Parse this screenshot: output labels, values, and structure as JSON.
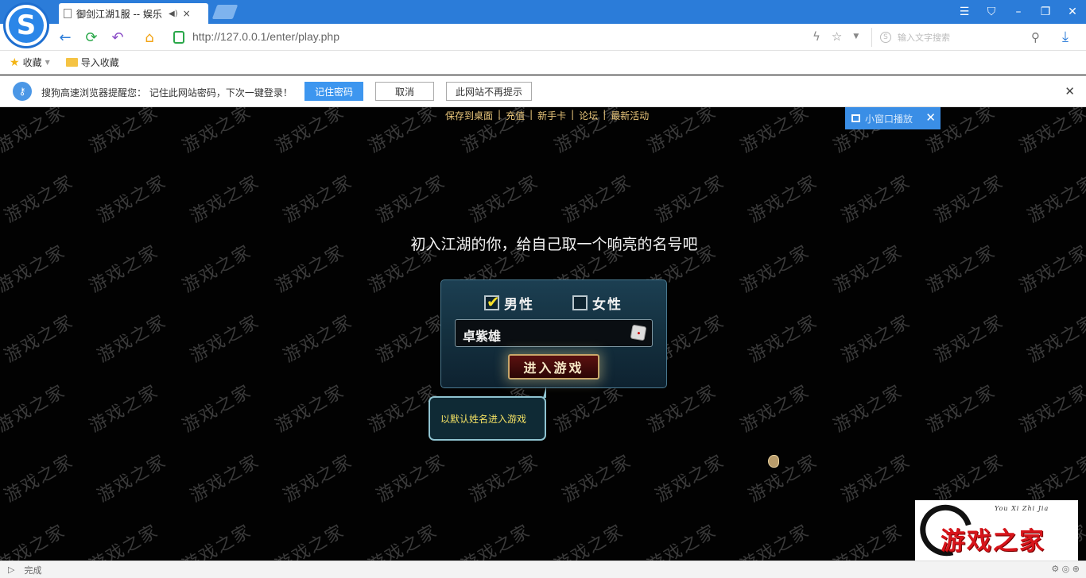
{
  "browser": {
    "tab": {
      "title": "御剑江湖1服 -- 娱乐",
      "close": "×"
    },
    "window_buttons": [
      "☰",
      "⛉",
      "–",
      "❐",
      "✕"
    ],
    "nav": {
      "back": "←",
      "refresh": "⟳",
      "undo": "↶",
      "home": "⌂"
    },
    "url": "http://127.0.0.1/enter/play.php",
    "search_placeholder": "输入文字搜索",
    "bookmarks": [
      {
        "label": "收藏",
        "icon": "star-icon"
      },
      {
        "label": "导入收藏",
        "icon": "folder-icon"
      }
    ],
    "password_prompt": {
      "message": "搜狗高速浏览器提醒您： 记住此网站密码，下次一键登录！",
      "remember": "记住密码",
      "cancel": "取消",
      "never": "此网站不再提示"
    },
    "status": "完成"
  },
  "game": {
    "top_links": [
      "保存到桌面",
      "充值",
      "新手卡",
      "论坛",
      "最新活动"
    ],
    "mini_play": "小窗口播放",
    "headline": "初入江湖的你，给自己取一个响亮的名号吧",
    "gender_male": "男性",
    "gender_female": "女性",
    "male_checked": true,
    "name_value": "卓紫雄",
    "enter_button": "进入游戏",
    "tooltip": "以默认姓名进入游戏",
    "watermark": "游戏之家",
    "corner_brand": "游戏之家",
    "corner_script": "You Xi Zhi Jia"
  },
  "colors": {
    "browser_blue": "#2b7cd9",
    "link_gold": "#e8c57a",
    "tooltip_yellow": "#f2e063",
    "brand_red": "#d7141a"
  }
}
